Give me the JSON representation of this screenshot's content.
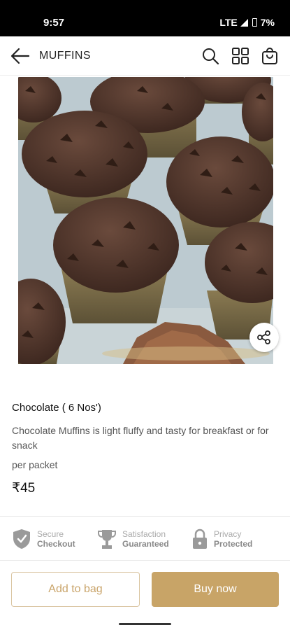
{
  "status_bar": {
    "time": "9:57",
    "network": "LTE",
    "battery": "7%"
  },
  "header": {
    "title": "MUFFINS",
    "back_icon": "arrow-left-icon",
    "search_icon": "search-icon",
    "grid_icon": "grid-icon",
    "bag_icon": "shopping-bag-icon"
  },
  "product": {
    "image_alt": "chocolate-muffins-photo",
    "name": "Chocolate ( 6 Nos')",
    "description": "Chocolate Muffins is light fluffy and tasty for breakfast or for snack",
    "unit": "per packet",
    "price": "₹45",
    "share_icon": "share-icon"
  },
  "badges": [
    {
      "icon": "shield-check-icon",
      "line1": "Secure",
      "line2": "Checkout"
    },
    {
      "icon": "trophy-icon",
      "line1": "Satisfaction",
      "line2": "Guaranteed"
    },
    {
      "icon": "lock-icon",
      "line1": "Privacy",
      "line2": "Protected"
    }
  ],
  "actions": {
    "add_to_bag": "Add to bag",
    "buy_now": "Buy now"
  },
  "colors": {
    "accent": "#c8a467",
    "accent_outline": "#d9c4a0",
    "status_bar": "#000000"
  }
}
